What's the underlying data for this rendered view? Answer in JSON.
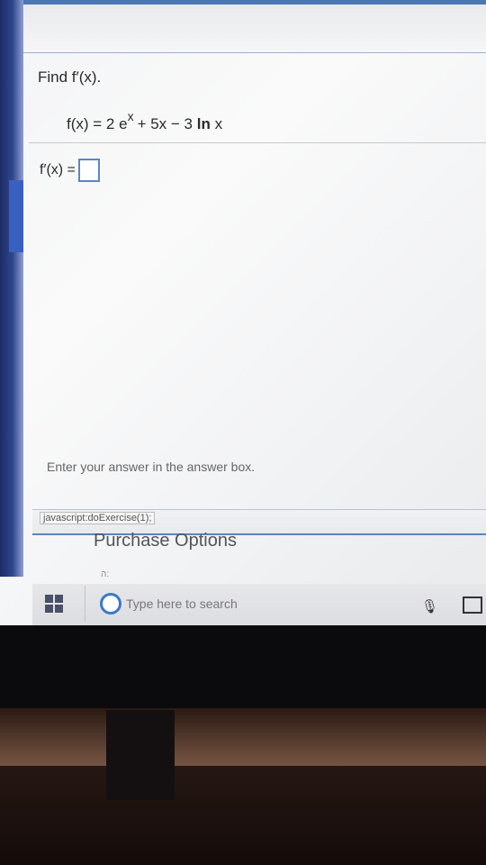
{
  "question": {
    "title": "Find f′(x).",
    "formula_lhs": "f(x) = 2 e",
    "formula_exp": "x",
    "formula_rhs": "+ 5x − 3 ",
    "formula_ln": "ln",
    "formula_tail": " x",
    "answer_label": "f′(x) =",
    "answer_value": ""
  },
  "hint": "Enter your answer in the answer box.",
  "status": {
    "link": "javascript:doExercise(1);"
  },
  "purchase": "Purchase Options",
  "tiny": "ה:",
  "taskbar": {
    "search_placeholder": "Type here to search"
  },
  "colors": {
    "accent": "#4b78b5",
    "answer_border": "#5b86c6",
    "search_ring": "#3d78c6"
  }
}
